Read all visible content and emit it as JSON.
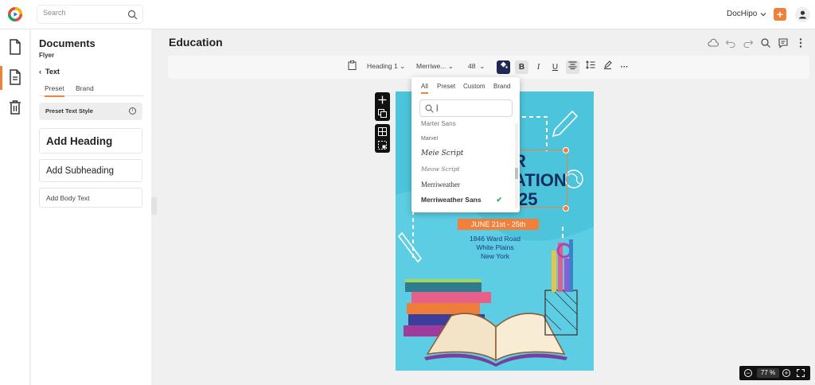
{
  "topbar": {
    "logo_icon": "dochipo-logo-icon",
    "search_placeholder": "Search",
    "account_name": "DocHipo",
    "plus_label": "+"
  },
  "rail": {
    "items": [
      {
        "icon": "document-icon",
        "active": false
      },
      {
        "icon": "document-lines-icon",
        "active": true
      },
      {
        "icon": "trash-icon",
        "active": false
      }
    ]
  },
  "panel": {
    "title": "Documents",
    "subtitle": "Flyer",
    "back_label": "Text",
    "tabs": [
      "Preset",
      "Brand"
    ],
    "preset_text_style": "Preset Text Style",
    "add_heading": "Add Heading",
    "add_subheading": "Add Subheading",
    "add_body": "Add Body Text"
  },
  "main": {
    "doc_title": "Education"
  },
  "toolbar": {
    "style_select": "Heading 1",
    "font_select": "Merriwe...",
    "size_select": "48",
    "bold": "B",
    "italic": "I",
    "underline": "U",
    "more": "···"
  },
  "font_dropdown": {
    "tabs": [
      "All",
      "Preset",
      "Custom",
      "Brand"
    ],
    "search_value": "|",
    "fonts": [
      "Marter Sans",
      "Marvel",
      "Meie Script",
      "Meow Script",
      "Merriweather",
      "Merriweather Sans"
    ],
    "selected": "Merriweather Sans"
  },
  "canvas": {
    "heading_lines": [
      "e",
      "R",
      "ATION",
      "25"
    ],
    "date_badge": "JUNE 21st - 25th",
    "address": [
      "1846 Ward Road",
      "White Plains",
      "New York"
    ],
    "background_color": "#4cc4dc",
    "accent_color": "#f2803b",
    "text_color": "#132e5e"
  },
  "zoom": {
    "value": "77 %"
  }
}
